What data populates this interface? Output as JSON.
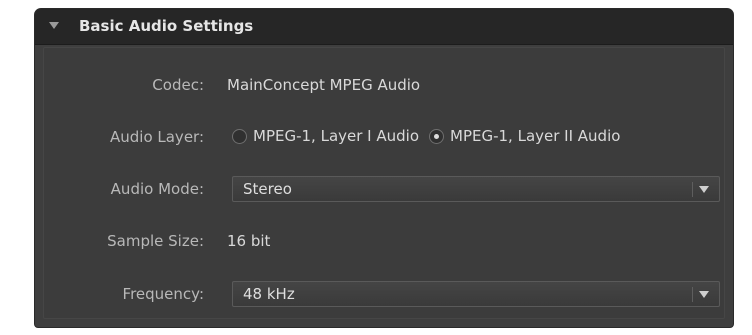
{
  "section": {
    "title": "Basic Audio Settings",
    "collapse_icon": "triangle-down-icon"
  },
  "codec": {
    "label": "Codec:",
    "value": "MainConcept MPEG Audio"
  },
  "audio_layer": {
    "label": "Audio Layer:",
    "options": [
      {
        "label": "MPEG-1, Layer I Audio",
        "selected": false
      },
      {
        "label": "MPEG-1, Layer II Audio",
        "selected": true
      }
    ]
  },
  "audio_mode": {
    "label": "Audio Mode:",
    "value": "Stereo",
    "dropdown_icon": "chevron-down-icon"
  },
  "sample_size": {
    "label": "Sample Size:",
    "value": "16 bit"
  },
  "frequency": {
    "label": "Frequency:",
    "value": "48 kHz",
    "dropdown_icon": "chevron-down-icon"
  },
  "colors": {
    "panel_bg": "#3e3e3e",
    "header_bg": "#262626",
    "label_text": "#b8b8b8",
    "value_text": "#d9d9d9"
  }
}
